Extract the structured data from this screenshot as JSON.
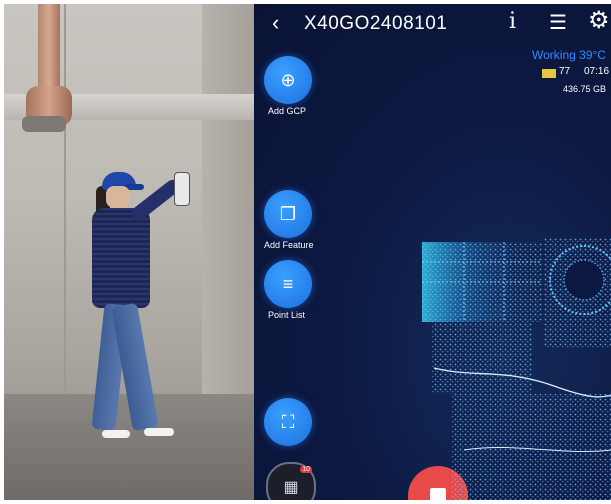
{
  "app": {
    "title": "X40GO2408101",
    "status_text": "Working",
    "temperature": "39°C",
    "battery": "77",
    "time": "07:16",
    "storage": "436.75 GB"
  },
  "actions": {
    "add_gcp": "Add GCP",
    "add_feature": "Add Feature",
    "point_list": "Point List",
    "badge": "10"
  },
  "icons": {
    "back": "chevron-left-icon",
    "info": "info-icon",
    "menu": "menu-icon",
    "settings": "gear-icon",
    "gcp": "gcp-pin-icon",
    "feature": "feature-doc-icon",
    "point_list": "list-pin-icon",
    "focus": "focus-frame-icon",
    "gallery": "gallery-icon",
    "stop": "stop-icon"
  },
  "colors": {
    "accent": "#1e6fe0",
    "status": "#2d8cff",
    "record": "#e84a4a",
    "background": "#0c1840",
    "point_cloud": "#38c7ff"
  }
}
